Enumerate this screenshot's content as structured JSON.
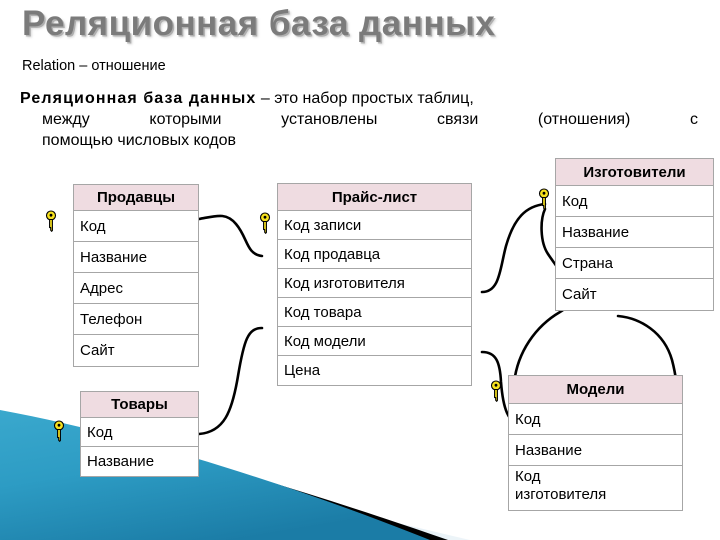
{
  "slide": {
    "title": "Реляционная база данных",
    "subline": "Relation – отношение",
    "paragraph": {
      "lead": "Реляционная база данных",
      "line1_rest": " – это набор простых таблиц,",
      "line2": "между которыми установлены связи (отношения) с",
      "line3": "помощью числовых кодов"
    }
  },
  "colors": {
    "title_text": "#7b7b7b",
    "header_fill": "#efdce1",
    "table_border": "#a6a6a6",
    "connector": "#000000",
    "key_icon": "#f7e11e",
    "decor_teal": "#2d9cc4",
    "decor_teal_dark": "#1c7ea8",
    "decor_pale": "#d6e8f0",
    "decor_black": "#000000"
  },
  "tables": [
    {
      "id": "prodavcy",
      "name": "Продавцы",
      "header": "Продавцы",
      "rows": [
        "Код",
        "Название",
        "Адрес",
        "Телефон",
        "Сайт"
      ],
      "key_row_index": 0
    },
    {
      "id": "price-list",
      "name": "Прайс-лист",
      "header": "Прайс-лист",
      "rows": [
        "Код записи",
        "Код продавца",
        "Код изготовителя",
        "Код товара",
        "Код модели",
        "Цена"
      ],
      "key_row_index": 0
    },
    {
      "id": "izgotoviteli",
      "name": "Изготовители",
      "header": "Изготовители",
      "rows": [
        "Код",
        "Название",
        "Страна",
        "Сайт"
      ],
      "key_row_index": 0
    },
    {
      "id": "tovary",
      "name": "Товары",
      "header": "Товары",
      "rows": [
        "Код",
        "Название"
      ],
      "key_row_index": 0
    },
    {
      "id": "modeli",
      "name": "Модели",
      "header": "Модели",
      "rows": [
        "Код",
        "Название",
        "Код изготовителя"
      ],
      "key_row_index": 0
    }
  ],
  "relations": [
    {
      "from": "Продавцы.Код",
      "to": "Прайс-лист.Код продавца"
    },
    {
      "from": "Товары.Код",
      "to": "Прайс-лист.Код товара"
    },
    {
      "from": "Изготовители.Код",
      "to": "Прайс-лист.Код изготовителя"
    },
    {
      "from": "Модели.Код",
      "to": "Прайс-лист.Код модели"
    },
    {
      "from": "Изготовители.Код",
      "to": "Модели.Код изготовителя"
    }
  ]
}
